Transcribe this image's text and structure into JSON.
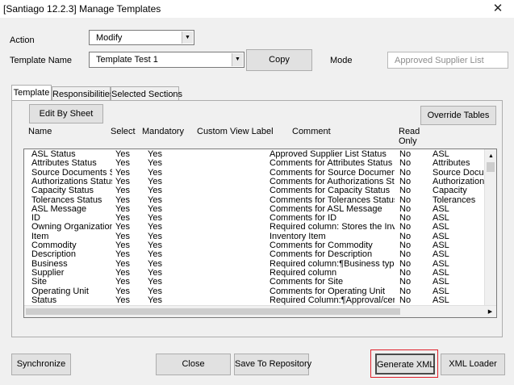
{
  "window": {
    "title": "[Santiago 12.2.3] Manage Templates",
    "close_glyph": "✕"
  },
  "form": {
    "action_label": "Action",
    "action_value": "Modify",
    "template_name_label": "Template Name",
    "template_name_value": "Template Test 1",
    "copy_label": "Copy",
    "mode_label": "Mode",
    "mode_value": "Approved Supplier List"
  },
  "tabs": [
    {
      "label": "Template",
      "active": true
    },
    {
      "label": "Responsibilities",
      "active": false
    },
    {
      "label": "Selected Sections",
      "active": false
    }
  ],
  "panel": {
    "edit_by_sheet_label": "Edit By Sheet",
    "override_tables_label": "Override Tables"
  },
  "table": {
    "columns": [
      "Name",
      "Select",
      "Mandatory",
      "Custom View Label",
      "Comment",
      "Read Only"
    ],
    "read_only_line1": "Read",
    "read_only_line2": "Only",
    "rows": [
      [
        "ASL Status",
        "Yes",
        "Yes",
        "",
        "Approved Supplier List Status",
        "No",
        "ASL"
      ],
      [
        "Attributes Status",
        "Yes",
        "Yes",
        "",
        "Comments for Attributes Status",
        "No",
        "Attributes"
      ],
      [
        "Source Documents Stat",
        "Yes",
        "Yes",
        "",
        "Comments for Source Documents Sta",
        "No",
        "Source Docume"
      ],
      [
        "Authorizations Status",
        "Yes",
        "Yes",
        "",
        "Comments for Authorizations Status",
        "No",
        "Authorizations"
      ],
      [
        "Capacity Status",
        "Yes",
        "Yes",
        "",
        "Comments for Capacity Status",
        "No",
        "Capacity"
      ],
      [
        "Tolerances Status",
        "Yes",
        "Yes",
        "",
        "Comments for Tolerances Status",
        "No",
        "Tolerances"
      ],
      [
        "ASL Message",
        "Yes",
        "Yes",
        "",
        "Comments for ASL Message",
        "No",
        "ASL"
      ],
      [
        "ID",
        "Yes",
        "Yes",
        "",
        "Comments for ID",
        "No",
        "ASL"
      ],
      [
        "Owning Organization",
        "Yes",
        "Yes",
        "",
        "Required column:  Stores the Invento",
        "No",
        "ASL"
      ],
      [
        "Item",
        "Yes",
        "Yes",
        "",
        "Inventory Item",
        "No",
        "ASL"
      ],
      [
        "Commodity",
        "Yes",
        "Yes",
        "",
        "Comments for Commodity",
        "No",
        "ASL"
      ],
      [
        "Description",
        "Yes",
        "Yes",
        "",
        "Comments for Description",
        "No",
        "ASL"
      ],
      [
        "Business",
        "Yes",
        "Yes",
        "",
        "Required column:¶Business type of D",
        "No",
        "ASL"
      ],
      [
        "Supplier",
        "Yes",
        "Yes",
        "",
        "Required column",
        "No",
        "ASL"
      ],
      [
        "Site",
        "Yes",
        "Yes",
        "",
        "Comments for Site",
        "No",
        "ASL"
      ],
      [
        "Operating Unit",
        "Yes",
        "Yes",
        "",
        "Comments for Operating Unit",
        "No",
        "ASL"
      ],
      [
        "Status",
        "Yes",
        "Yes",
        "",
        "Required Column:¶Approval/certifica",
        "No",
        "ASL"
      ]
    ]
  },
  "footer": {
    "synchronize_label": "Synchronize",
    "close_label": "Close",
    "save_label": "Save To Repository",
    "generate_label": "Generate XML",
    "xml_loader_label": "XML Loader"
  }
}
